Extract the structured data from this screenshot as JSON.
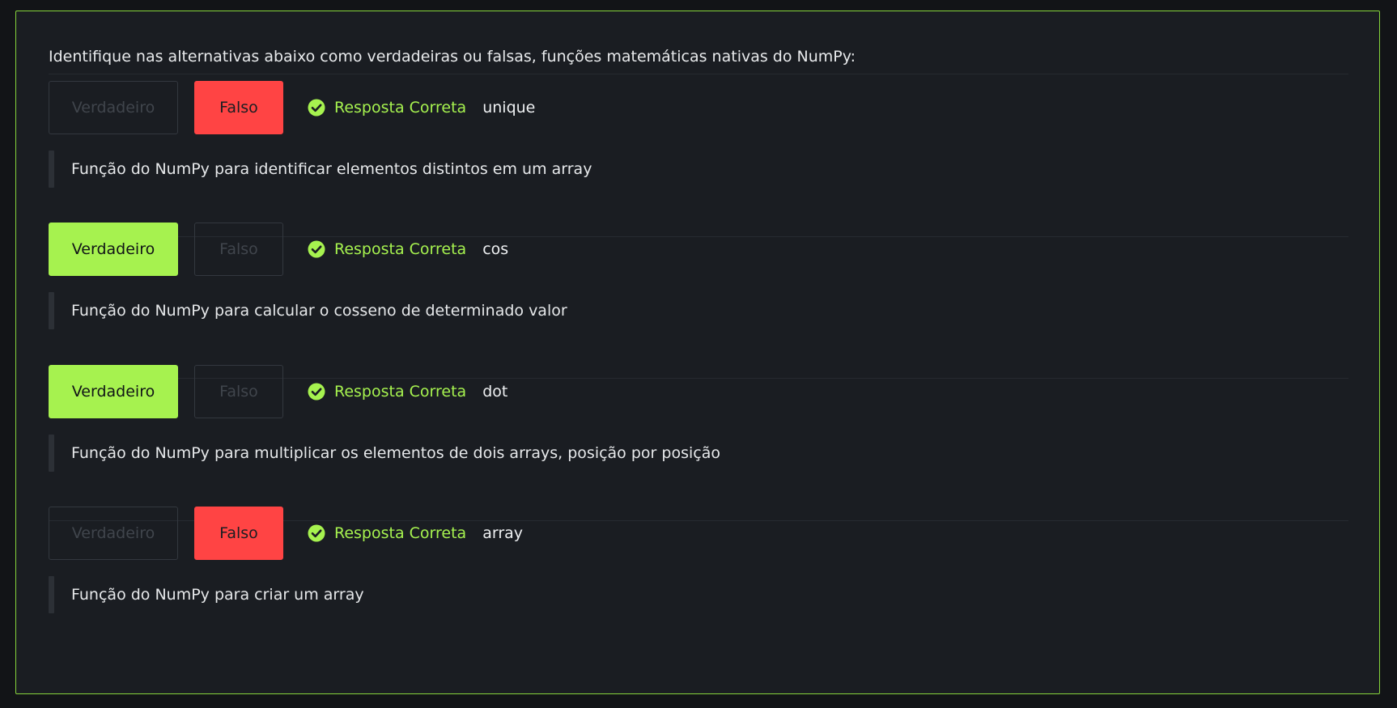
{
  "question": {
    "title": "Identifique nas alternativas abaixo como verdadeiras ou falsas, funções matemáticas nativas do NumPy:"
  },
  "labels": {
    "true_button": "Verdadeiro",
    "false_button": "Falso",
    "correct_status": "Resposta Correta"
  },
  "colors": {
    "accent_green": "#a6f24f",
    "false_red": "#ff4444",
    "panel_border": "#86d43c"
  },
  "items": [
    {
      "selected": "false",
      "answer": "unique",
      "description": "Função do NumPy para identificar elementos distintos em um array"
    },
    {
      "selected": "true",
      "answer": "cos",
      "description": "Função do NumPy para calcular o cosseno de determinado valor"
    },
    {
      "selected": "true",
      "answer": "dot",
      "description": "Função do NumPy para multiplicar os elementos de dois arrays, posição por posição"
    },
    {
      "selected": "false",
      "answer": "array",
      "description": "Função do NumPy para criar um array"
    }
  ]
}
